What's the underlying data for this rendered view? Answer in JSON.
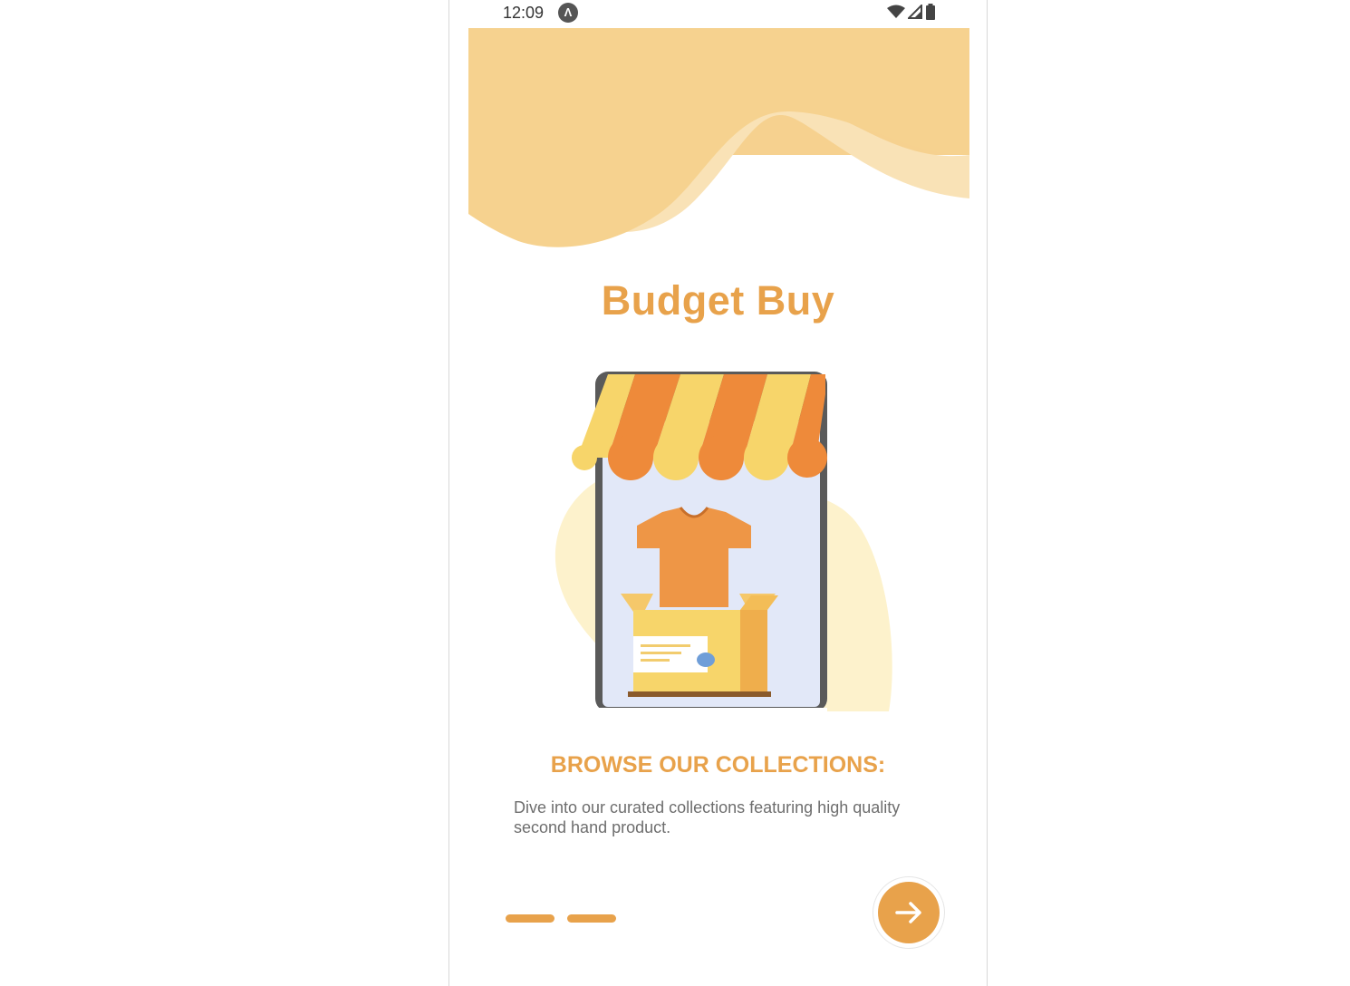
{
  "status_bar": {
    "time": "12:09",
    "app_icon_glyph": "Λ",
    "icons": [
      "wifi-icon",
      "signal-icon",
      "battery-icon"
    ]
  },
  "onboarding": {
    "app_title": "Budget Buy",
    "illustration": "storefront-tshirt-box-icon",
    "heading": "BROWSE OUR COLLECTIONS:",
    "description": "Dive into our curated collections featuring high quality second hand product.",
    "page_indicator": {
      "pages": 2
    },
    "next_button_icon": "arrow-right-icon"
  },
  "colors": {
    "accent": "#e8a24b",
    "wave_light": "#f7d9a4",
    "awning_orange": "#ee8a3a",
    "awning_yellow": "#f7d56a",
    "screen_bg": "#e2e8f8",
    "text_gray": "#6e6e6e"
  }
}
